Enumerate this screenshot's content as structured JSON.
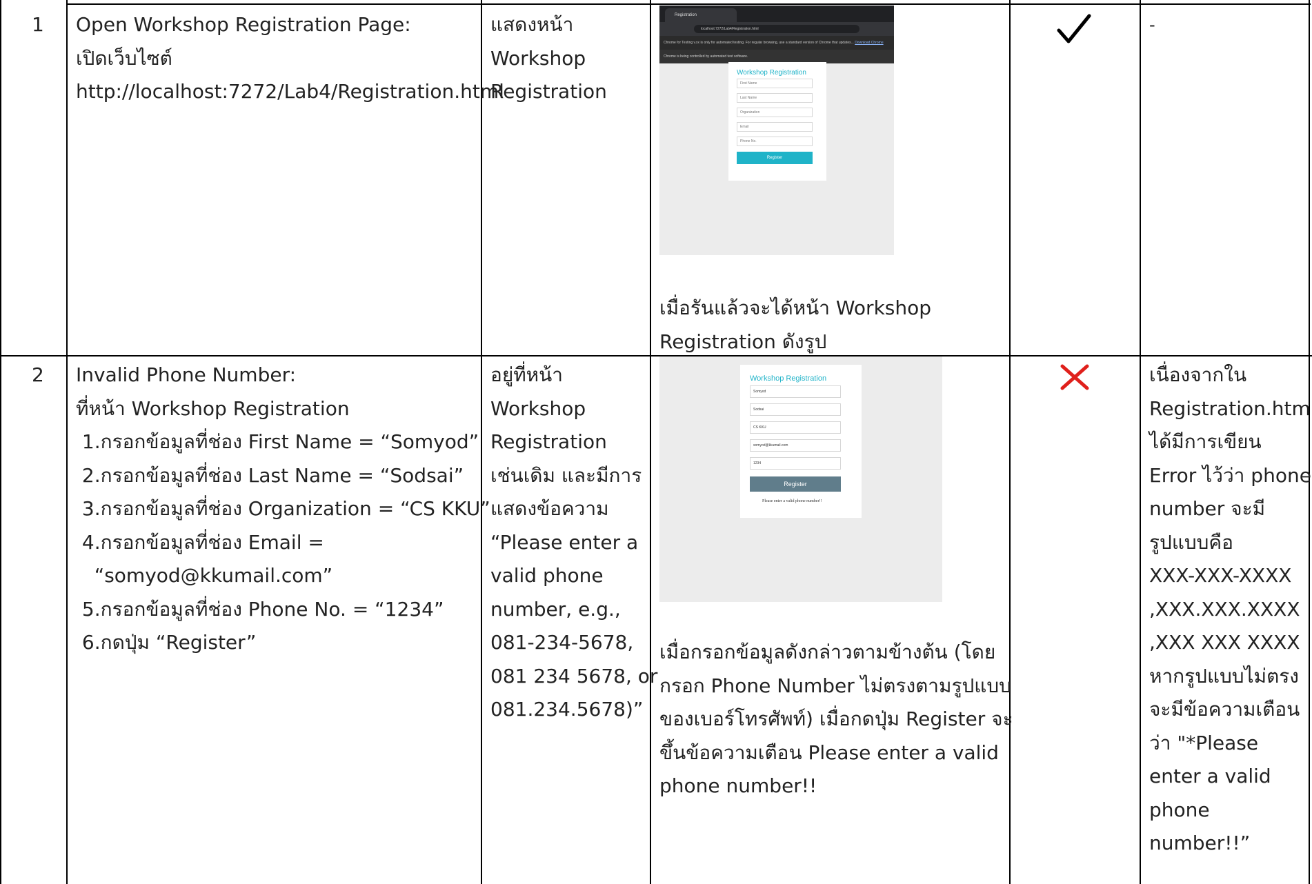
{
  "rows": [
    {
      "number": "1",
      "step": [
        "Open Workshop Registration Page:",
        "เปิดเว็บไซต์",
        "http://localhost:7272/Lab4/Registration.html"
      ],
      "expected": [
        "แสดงหน้า",
        "Workshop",
        "Registration"
      ],
      "actual_caption": [
        "เมื่อรันแล้วจะได้หน้า Workshop",
        "Registration ดังรูป"
      ],
      "result": "pass",
      "result_icon": "check-icon",
      "remark": "-",
      "screenshot": {
        "tab_title": "Registration",
        "url": "localhost:7272/Lab4/Registration.html",
        "info_bar": "Chrome for Testing v.xx is only for automated testing. For regular browsing, use a standard version of Chrome that updates...",
        "info_link": "Download Chrome",
        "automation_bar": "Chrome is being controlled by automated test software.",
        "form_title": "Workshop Registration",
        "fields": [
          "First Name",
          "Last Name",
          "Organization",
          "Email",
          "Phone No."
        ],
        "button": "Register"
      }
    },
    {
      "number": "2",
      "step": [
        "Invalid Phone Number:",
        "ที่หน้า Workshop Registration",
        " 1.กรอกข้อมูลที่ช่อง First Name = “Somyod”",
        " 2.กรอกข้อมูลที่ช่อง Last Name = “Sodsai”",
        " 3.กรอกข้อมูลที่ช่อง Organization = “CS KKU”",
        " 4.กรอกข้อมูลที่ช่อง Email =",
        "   “somyod@kkumail.com”",
        " 5.กรอกข้อมูลที่ช่อง Phone No. = “1234”",
        " 6.กดปุ่ม “Register”"
      ],
      "expected": [
        "อยู่ที่หน้า",
        "Workshop",
        "Registration",
        "เช่นเดิม และมีการ",
        "แสดงข้อความ",
        "“Please enter a",
        "valid phone",
        "number, e.g.,",
        "081-234-5678,",
        "081 234 5678, or",
        "081.234.5678)”"
      ],
      "actual_caption": [
        "เมื่อกรอกข้อมูลดังกล่าวตามข้างต้น (โดย",
        "กรอก Phone Number ไม่ตรงตามรูปแบบ",
        "ของเบอร์โทรศัพท์) เมื่อกดปุ่ม Register จะ",
        "ขึ้นข้อความเตือน Please enter a valid",
        "phone number!!"
      ],
      "result": "fail",
      "result_icon": "cross-icon",
      "remark": [
        "เนื่องจากใน",
        "Registration.html",
        "ได้มีการเขียน",
        "Error ไว้ว่า phone",
        "number จะมี",
        "รูปแบบคือ",
        "XXX-XXX-XXXX",
        ",XXX.XXX.XXXX",
        ",XXX XXX XXXX",
        "หากรูปแบบไม่ตรง",
        "จะมีข้อความเตือน",
        "ว่า \"*Please",
        "enter a valid",
        "phone",
        "number!!”"
      ],
      "screenshot": {
        "form_title": "Workshop Registration",
        "values": [
          "Somyod",
          "Sodsai",
          "CS KKU",
          "somyod@kkumail.com",
          "1234"
        ],
        "button": "Register",
        "error": "Please enter a valid phone number!!"
      }
    }
  ],
  "colors": {
    "check": "#000000",
    "cross": "#e0201b",
    "accent": "#1fb3c8",
    "button_disabled": "#607d8b"
  }
}
